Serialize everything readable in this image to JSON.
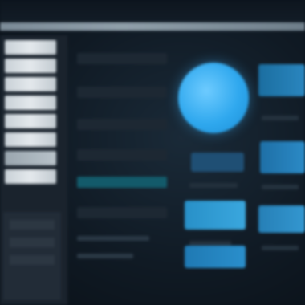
{
  "window": {
    "title": ""
  },
  "sidebar": {
    "items": [
      {
        "label": "",
        "variant": "bright"
      },
      {
        "label": "",
        "variant": "bright"
      },
      {
        "label": "",
        "variant": "bright"
      },
      {
        "label": "",
        "variant": "bright"
      },
      {
        "label": "",
        "variant": "bright"
      },
      {
        "label": "",
        "variant": "bright"
      },
      {
        "label": "",
        "variant": "dim"
      },
      {
        "label": "",
        "variant": "bright"
      }
    ]
  },
  "list": {
    "rows": [
      {
        "label": "",
        "selected": false
      },
      {
        "label": "",
        "selected": false
      },
      {
        "label": "",
        "selected": false
      },
      {
        "label": "",
        "selected": false
      },
      {
        "label": "",
        "selected": true
      },
      {
        "label": "",
        "selected": false
      }
    ]
  },
  "profile": {
    "avatar_icon": "user-avatar-icon",
    "avatar_color": "#2fa8ee"
  },
  "buttons": {
    "primary_a": "",
    "primary_b": "",
    "primary_c": "",
    "right_1": "",
    "right_2": "",
    "right_3": ""
  },
  "colors": {
    "background": "#101a24",
    "accent": "#2fa8ee",
    "selection": "#135a6a",
    "sidebar_item": "#d6dde2"
  }
}
